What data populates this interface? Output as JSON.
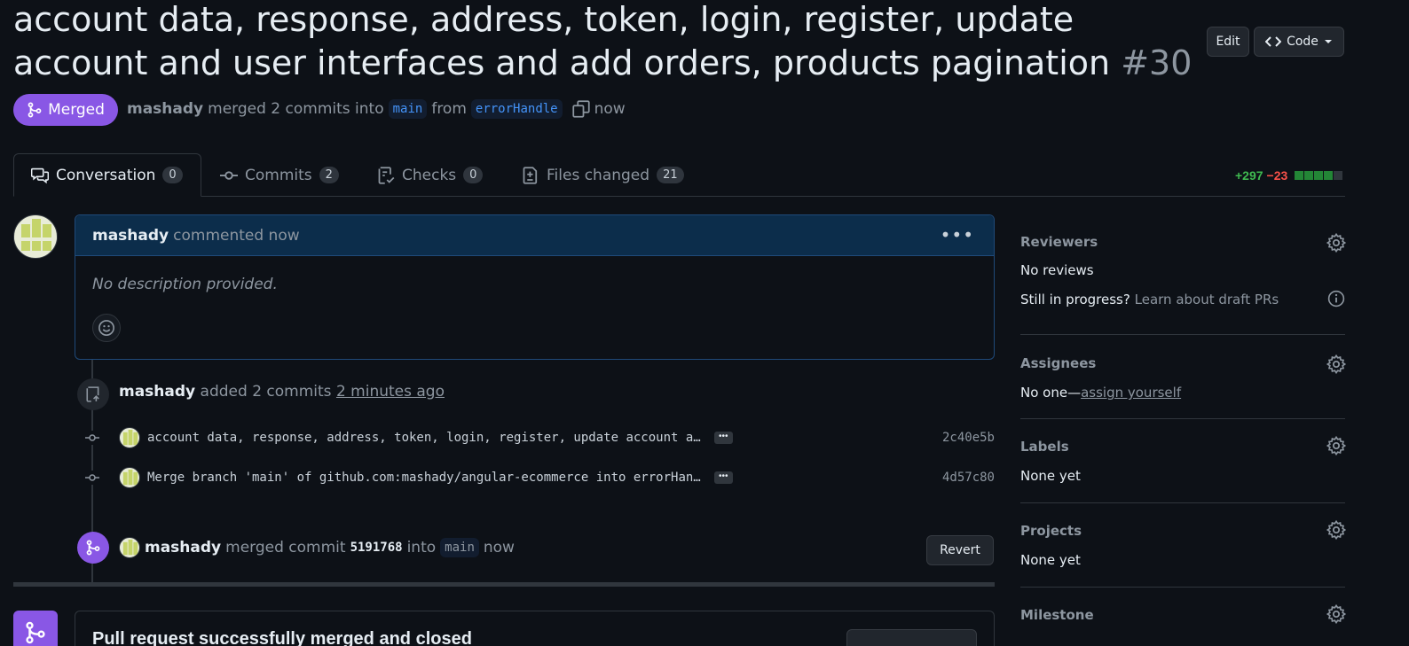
{
  "pr": {
    "title": "account data, response, address, token, login, register, update account and user interfaces and add orders, products pagination",
    "number": "#30",
    "state": "Merged",
    "author": "mashady",
    "merged_text": "merged 2 commits into",
    "base_branch": "main",
    "from_text": "from",
    "head_branch": "errorHandle",
    "time": "now"
  },
  "header_buttons": {
    "edit": "Edit",
    "code": "Code"
  },
  "tabs": [
    {
      "label": "Conversation",
      "count": "0"
    },
    {
      "label": "Commits",
      "count": "2"
    },
    {
      "label": "Checks",
      "count": "0"
    },
    {
      "label": "Files changed",
      "count": "21"
    }
  ],
  "diffstat": {
    "additions": "+297",
    "deletions": "−23"
  },
  "comment": {
    "author": "mashady",
    "action": "commented now",
    "body": "No description provided."
  },
  "push_event": {
    "author": "mashady",
    "text": "added 2 commits",
    "time": "2 minutes ago"
  },
  "commits": [
    {
      "message": "account data, response, address, token, login, register, update account and user interfaces",
      "sha": "2c40e5b"
    },
    {
      "message": "Merge branch 'main' of github.com:mashady/angular-ecommerce into errorHandle",
      "sha": "4d57c80"
    }
  ],
  "merge_event": {
    "author": "mashady",
    "text": "merged commit",
    "sha": "5191768",
    "into": "into",
    "branch": "main",
    "time": "now",
    "revert": "Revert"
  },
  "bottom": {
    "title": "Pull request successfully merged and closed"
  },
  "sidebar": {
    "reviewers": {
      "title": "Reviewers",
      "value": "No reviews",
      "draft_q": "Still in progress?",
      "draft_link": "Learn about draft PRs"
    },
    "assignees": {
      "title": "Assignees",
      "value": "No one—",
      "link": "assign yourself"
    },
    "labels": {
      "title": "Labels",
      "value": "None yet"
    },
    "projects": {
      "title": "Projects",
      "value": "None yet"
    },
    "milestone": {
      "title": "Milestone"
    }
  },
  "colors": {
    "merged": "#8957e5",
    "accent": "#4493f8",
    "add": "#3fb950",
    "del": "#f85149"
  }
}
